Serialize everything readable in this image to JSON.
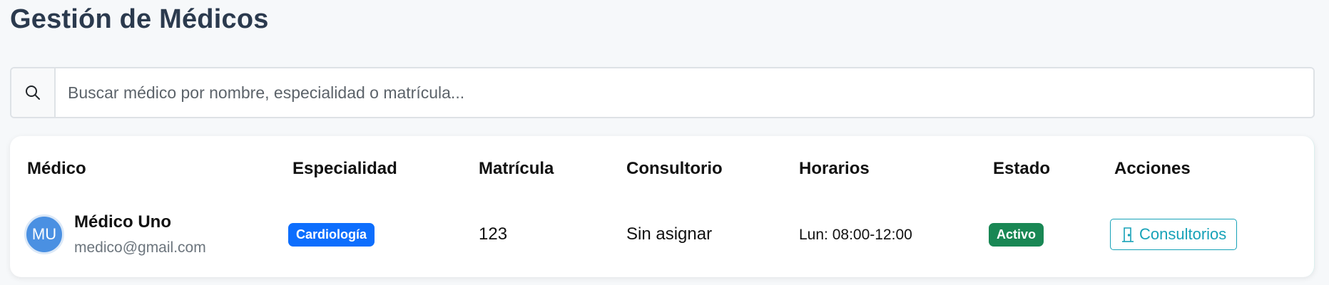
{
  "page": {
    "title": "Gestión de Médicos"
  },
  "search": {
    "placeholder": "Buscar médico por nombre, especialidad o matrícula...",
    "value": ""
  },
  "table": {
    "headers": {
      "medico": "Médico",
      "especialidad": "Especialidad",
      "matricula": "Matrícula",
      "consultorio": "Consultorio",
      "horarios": "Horarios",
      "estado": "Estado",
      "acciones": "Acciones"
    },
    "rows": [
      {
        "initials": "MU",
        "name": "Médico Uno",
        "email": "medico@gmail.com",
        "especialidad": "Cardiología",
        "matricula": "123",
        "consultorio": "Sin asignar",
        "horarios": "Lun: 08:00-12:00",
        "estado": "Activo",
        "action_label": "Consultorios"
      }
    ]
  },
  "colors": {
    "title": "#2b3a4e",
    "avatar": "#4a90e2",
    "badge_especialidad": "#0d6efd",
    "badge_estado": "#198754",
    "action_outline": "#17a2b8"
  },
  "icons": {
    "search": "search-icon",
    "action": "door-icon"
  }
}
